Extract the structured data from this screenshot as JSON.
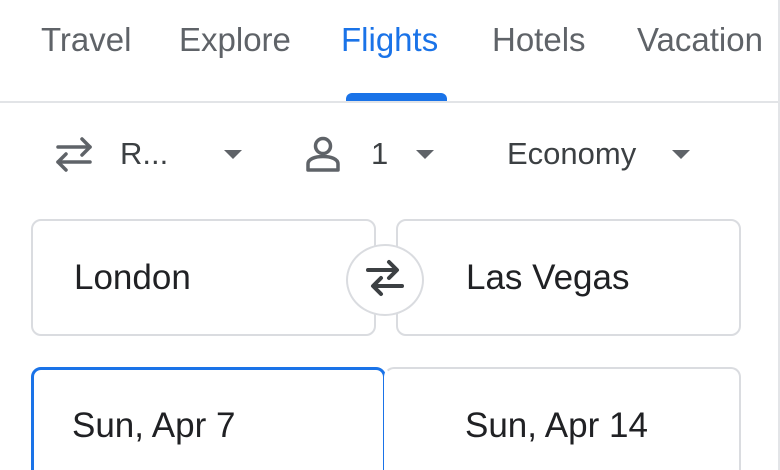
{
  "nav": {
    "tabs": [
      {
        "label": "Travel"
      },
      {
        "label": "Explore"
      },
      {
        "label": "Flights"
      },
      {
        "label": "Hotels"
      },
      {
        "label": "Vacation"
      }
    ],
    "active_tab": "Flights"
  },
  "options": {
    "trip_type": {
      "label": "R...",
      "icon": "swap-horiz-icon"
    },
    "passengers": {
      "count": "1",
      "icon": "person-icon"
    },
    "cabin_class": {
      "label": "Economy"
    }
  },
  "search": {
    "origin": "London",
    "destination": "Las Vegas",
    "swap_icon": "swap-arrows-icon",
    "depart_date": "Sun, Apr 7",
    "return_date": "Sun, Apr 14"
  },
  "colors": {
    "accent": "#1a73e8",
    "text": "#3c4043",
    "muted": "#5f6368",
    "border": "#dadce0"
  }
}
